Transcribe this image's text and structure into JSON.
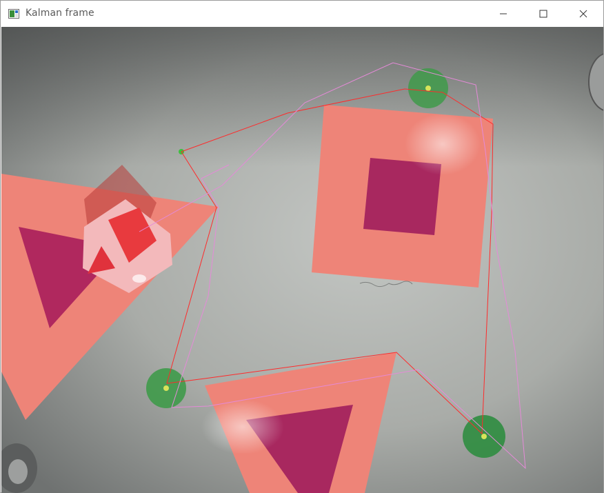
{
  "window": {
    "title": "Kalman frame",
    "icon": "opencv-window-icon",
    "controls": {
      "minimize_icon": "minimize-icon",
      "maximize_icon": "maximize-icon",
      "close_icon": "close-icon"
    }
  },
  "scene": {
    "background_color": "#a9aca8",
    "shape_color": "#ee8478",
    "inner_shape_color": "#a8285f",
    "marker_color": "#3f9a4a",
    "marker_center_color": "#d8e35a",
    "measured_path_color": "#ff2a2a",
    "kalman_path_color": "#e58ad8"
  }
}
